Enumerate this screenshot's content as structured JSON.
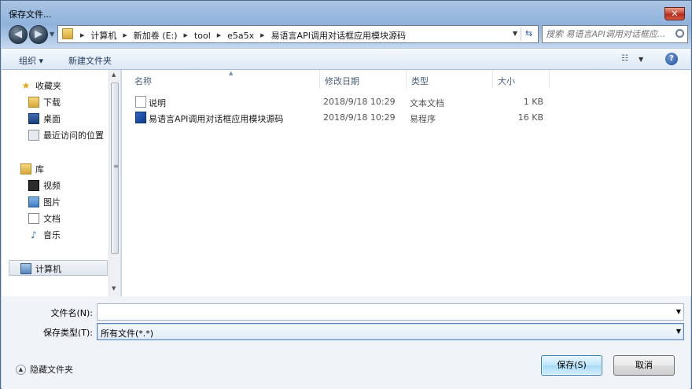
{
  "window": {
    "title": "保存文件..."
  },
  "address": {
    "crumbs": [
      "计算机",
      "新加卷 (E:)",
      "tool",
      "e5a5x",
      "易语言API调用对话框应用模块源码"
    ]
  },
  "search": {
    "placeholder": "搜索 易语言API调用对话框应..."
  },
  "toolbar": {
    "organize_label": "组织 ▾",
    "new_folder_label": "新建文件夹"
  },
  "sidebar": {
    "favorites": "收藏夹",
    "downloads": "下载",
    "desktop": "桌面",
    "recent": "最近访问的位置",
    "libraries": "库",
    "videos": "视频",
    "pictures": "图片",
    "documents": "文档",
    "music": "音乐",
    "computer": "计算机"
  },
  "columns": {
    "name": "名称",
    "date": "修改日期",
    "type": "类型",
    "size": "大小"
  },
  "files": [
    {
      "name": "说明",
      "date": "2018/9/18 10:29",
      "type": "文本文档",
      "size": "1 KB"
    },
    {
      "name": "易语言API调用对话框应用模块源码",
      "date": "2018/9/18 10:29",
      "type": "易程序",
      "size": "16 KB"
    }
  ],
  "form": {
    "filename_label": "文件名(N):",
    "filename_value": "",
    "filetype_label": "保存类型(T):",
    "filetype_value": "所有文件(*.*)",
    "hide_folders_label": "隐藏文件夹",
    "save_label": "保存(S)",
    "cancel_label": "取消"
  }
}
